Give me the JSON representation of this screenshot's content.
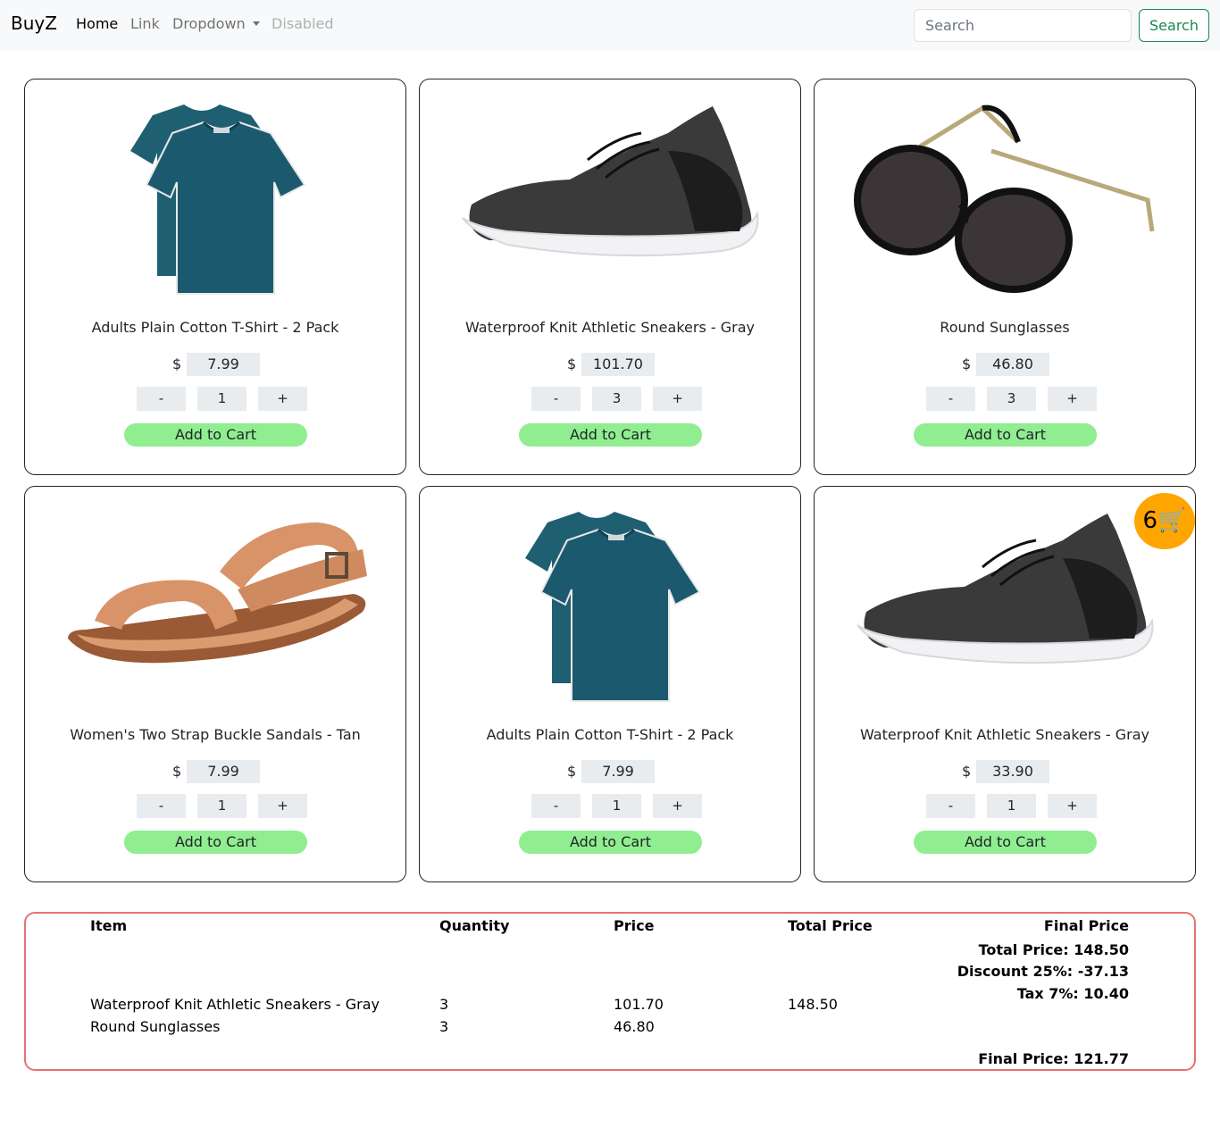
{
  "navbar": {
    "brand": "BuyZ",
    "links": [
      {
        "label": "Home",
        "state": "active"
      },
      {
        "label": "Link",
        "state": "normal"
      },
      {
        "label": "Dropdown",
        "state": "dropdown"
      },
      {
        "label": "Disabled",
        "state": "disabled"
      }
    ],
    "search_placeholder": "Search",
    "search_button": "Search"
  },
  "products": [
    {
      "title": "Adults Plain Cotton T-Shirt - 2 Pack",
      "currency": "$",
      "price": "7.99",
      "quantity": "1",
      "minus": "-",
      "plus": "+",
      "add_label": "Add to Cart",
      "image": "tshirt-image"
    },
    {
      "title": "Waterproof Knit Athletic Sneakers - Gray",
      "currency": "$",
      "price": "101.70",
      "quantity": "3",
      "minus": "-",
      "plus": "+",
      "add_label": "Add to Cart",
      "image": "sneaker-image"
    },
    {
      "title": "Round Sunglasses",
      "currency": "$",
      "price": "46.80",
      "quantity": "3",
      "minus": "-",
      "plus": "+",
      "add_label": "Add to Cart",
      "image": "sunglasses-image"
    },
    {
      "title": "Women's Two Strap Buckle Sandals - Tan",
      "currency": "$",
      "price": "7.99",
      "quantity": "1",
      "minus": "-",
      "plus": "+",
      "add_label": "Add to Cart",
      "image": "sandal-image"
    },
    {
      "title": "Adults Plain Cotton T-Shirt - 2 Pack",
      "currency": "$",
      "price": "7.99",
      "quantity": "1",
      "minus": "-",
      "plus": "+",
      "add_label": "Add to Cart",
      "image": "tshirt-image"
    },
    {
      "title": "Waterproof Knit Athletic Sneakers - Gray",
      "currency": "$",
      "price": "33.90",
      "quantity": "1",
      "minus": "-",
      "plus": "+",
      "add_label": "Add to Cart",
      "image": "sneaker-image"
    }
  ],
  "cart_badge": {
    "count": "6",
    "icon": "shopping-cart-icon"
  },
  "cart": {
    "headers": {
      "item": "Item",
      "quantity": "Quantity",
      "price": "Price",
      "total": "Total Price",
      "final": "Final Price"
    },
    "rows": [
      {
        "item": "Waterproof Knit Athletic Sneakers - Gray",
        "quantity": "3",
        "price": "101.70"
      },
      {
        "item": "Round Sunglasses",
        "quantity": "3",
        "price": "46.80"
      }
    ],
    "total_value": "148.50",
    "total_price_line": "Total Price: 148.50",
    "discount_line": "Discount 25%: -37.13",
    "tax_line": "Tax 7%: 10.40",
    "final_line": "Final Price: 121.77"
  },
  "colors": {
    "accent_green": "#198754",
    "add_button": "#90ee90",
    "badge": "#ffa500",
    "cart_border": "#e57373"
  }
}
